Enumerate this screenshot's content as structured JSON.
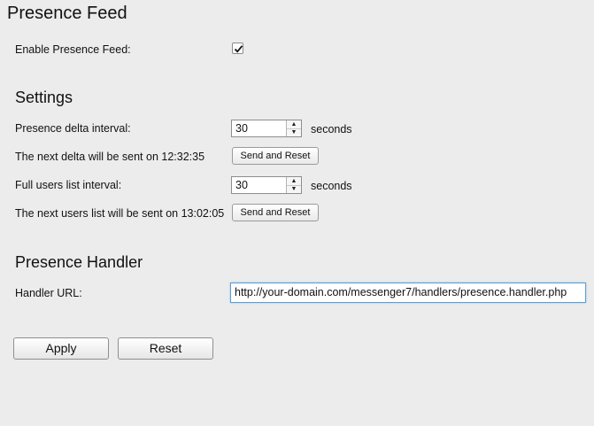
{
  "page_title": "Presence Feed",
  "enable_section": {
    "label": "Enable Presence Feed:",
    "checked": true
  },
  "settings": {
    "heading": "Settings",
    "delta_interval": {
      "label": "Presence delta interval:",
      "value": "30",
      "unit": "seconds"
    },
    "next_delta": {
      "label": "The next delta will be sent on 12:32:35",
      "button": "Send and Reset"
    },
    "users_interval": {
      "label": "Full users list interval:",
      "value": "30",
      "unit": "seconds"
    },
    "next_users": {
      "label": "The next users list will be sent on 13:02:05",
      "button": "Send and Reset"
    }
  },
  "handler": {
    "heading": "Presence Handler",
    "url_label": "Handler URL:",
    "url_value": "http://your-domain.com/messenger7/handlers/presence.handler.php"
  },
  "actions": {
    "apply": "Apply",
    "reset": "Reset"
  },
  "icons": {
    "check": "checkmark-icon",
    "spin_up": "arrow-up-icon",
    "spin_down": "arrow-down-icon"
  }
}
